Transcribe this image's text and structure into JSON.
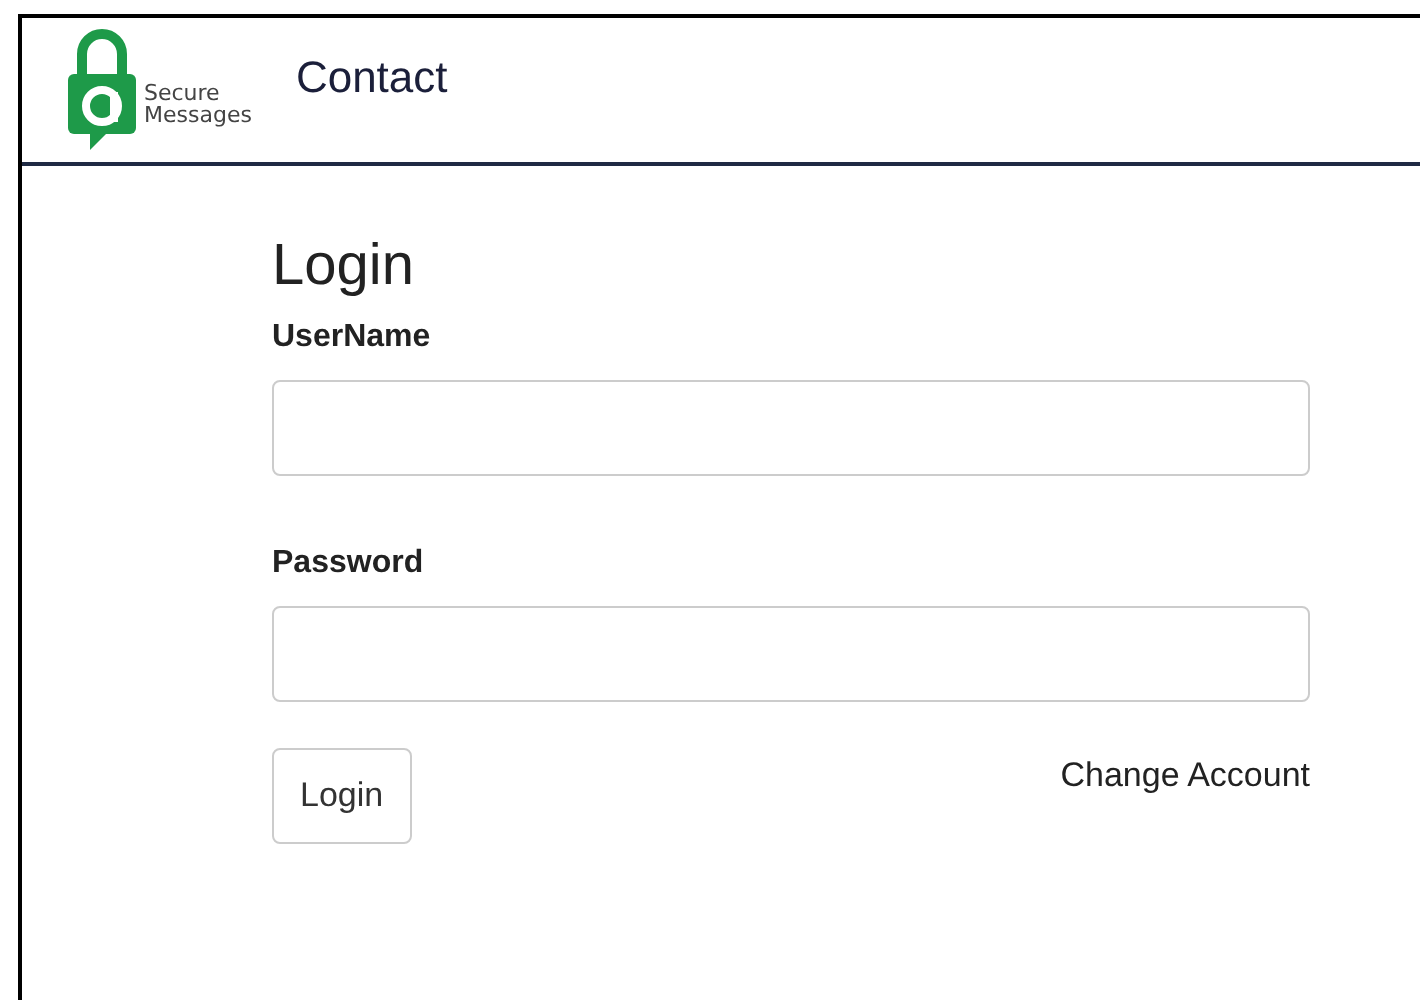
{
  "header": {
    "logo_text": [
      "Secure",
      "Messages"
    ],
    "nav": [
      {
        "label": "Contact"
      }
    ]
  },
  "login": {
    "title": "Login",
    "fields": [
      {
        "label": "UserName"
      },
      {
        "label": "Password"
      }
    ],
    "submit": "Login",
    "link": "Change Account"
  }
}
